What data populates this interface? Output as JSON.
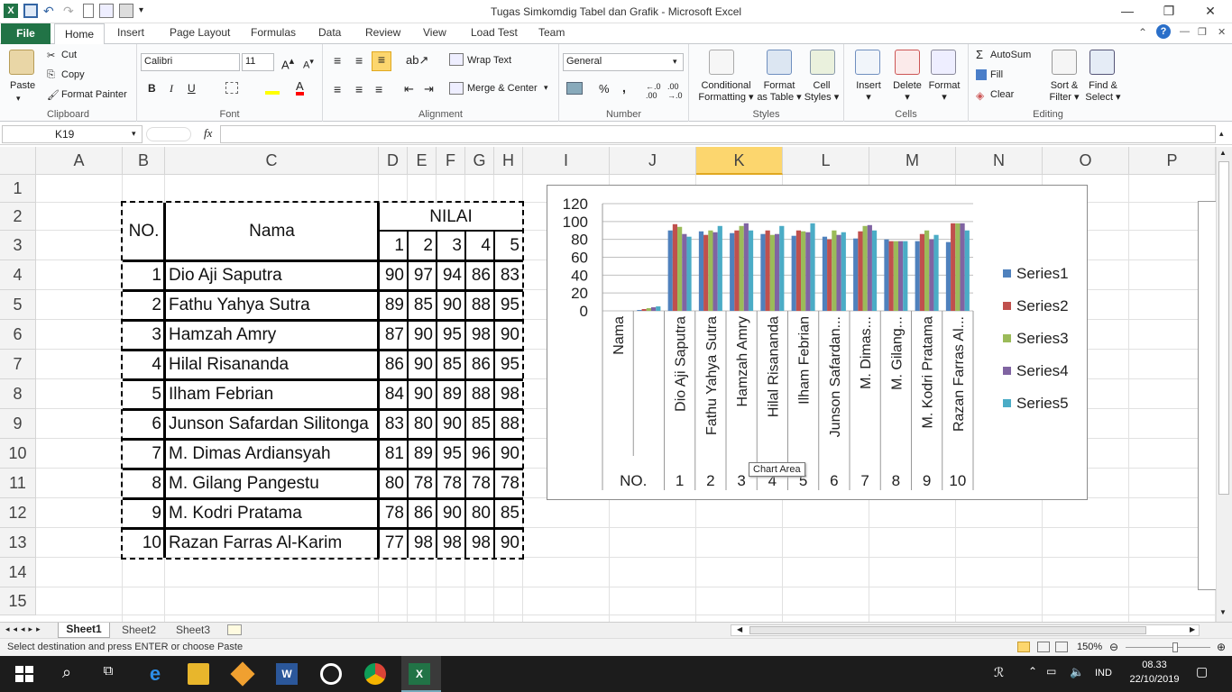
{
  "window": {
    "title": "Tugas Simkomdig Tabel dan Grafik  -  Microsoft Excel"
  },
  "tabs": [
    "File",
    "Home",
    "Insert",
    "Page Layout",
    "Formulas",
    "Data",
    "Review",
    "View",
    "Load Test",
    "Team"
  ],
  "ribbon": {
    "clipboard": {
      "paste": "Paste",
      "cut": "Cut",
      "copy": "Copy",
      "format_painter": "Format Painter",
      "label": "Clipboard"
    },
    "font": {
      "name": "Calibri",
      "size": "11",
      "bold": "B",
      "italic": "I",
      "underline": "U",
      "label": "Font"
    },
    "alignment": {
      "wrap": "Wrap Text",
      "merge": "Merge & Center",
      "label": "Alignment"
    },
    "number": {
      "format": "General",
      "percent": "%",
      "comma": ",",
      "label": "Number"
    },
    "styles": {
      "conditional_1": "Conditional",
      "conditional_2": "Formatting",
      "format_table_1": "Format",
      "format_table_2": "as Table",
      "cell_styles_1": "Cell",
      "cell_styles_2": "Styles",
      "label": "Styles"
    },
    "cells": {
      "insert": "Insert",
      "delete": "Delete",
      "format": "Format",
      "label": "Cells"
    },
    "editing": {
      "autosum": "AutoSum",
      "fill": "Fill",
      "clear": "Clear",
      "sort_1": "Sort &",
      "sort_2": "Filter",
      "find_1": "Find &",
      "find_2": "Select",
      "label": "Editing"
    }
  },
  "formula_bar": {
    "name_box": "K19",
    "fx": "fx",
    "value": ""
  },
  "columns": [
    "A",
    "B",
    "C",
    "D",
    "E",
    "F",
    "G",
    "H",
    "I",
    "J",
    "K",
    "L",
    "M",
    "N",
    "O",
    "P"
  ],
  "rows": [
    "1",
    "2",
    "3",
    "4",
    "5",
    "6",
    "7",
    "8",
    "9",
    "10",
    "11",
    "12",
    "13",
    "14",
    "15"
  ],
  "table": {
    "header_no": "NO.",
    "header_nama": "Nama",
    "header_nilai": "NILAI",
    "sub_headers": [
      "1",
      "2",
      "3",
      "4",
      "5"
    ],
    "data": [
      {
        "no": "1",
        "nama": "Dio Aji Saputra",
        "v": [
          "90",
          "97",
          "94",
          "86",
          "83"
        ]
      },
      {
        "no": "2",
        "nama": "Fathu Yahya Sutra",
        "v": [
          "89",
          "85",
          "90",
          "88",
          "95"
        ]
      },
      {
        "no": "3",
        "nama": "Hamzah Amry",
        "v": [
          "87",
          "90",
          "95",
          "98",
          "90"
        ]
      },
      {
        "no": "4",
        "nama": "Hilal Risananda",
        "v": [
          "86",
          "90",
          "85",
          "86",
          "95"
        ]
      },
      {
        "no": "5",
        "nama": "Ilham Febrian",
        "v": [
          "84",
          "90",
          "89",
          "88",
          "98"
        ]
      },
      {
        "no": "6",
        "nama": "Junson Safardan Silitonga",
        "v": [
          "83",
          "80",
          "90",
          "85",
          "88"
        ]
      },
      {
        "no": "7",
        "nama": "M. Dimas Ardiansyah",
        "v": [
          "81",
          "89",
          "95",
          "96",
          "90"
        ]
      },
      {
        "no": "8",
        "nama": "M. Gilang Pangestu",
        "v": [
          "80",
          "78",
          "78",
          "78",
          "78"
        ]
      },
      {
        "no": "9",
        "nama": "M. Kodri Pratama",
        "v": [
          "78",
          "86",
          "90",
          "80",
          "85"
        ]
      },
      {
        "no": "10",
        "nama": "Razan Farras Al-Karim",
        "v": [
          "77",
          "98",
          "98",
          "98",
          "90"
        ]
      }
    ]
  },
  "chart_data": {
    "type": "bar",
    "y_ticks": [
      "120",
      "100",
      "80",
      "60",
      "40",
      "20",
      "0"
    ],
    "ylim": [
      0,
      120
    ],
    "categories_outer": [
      "NO.",
      "1",
      "2",
      "3",
      "4",
      "5",
      "6",
      "7",
      "8",
      "9",
      "10"
    ],
    "categories_inner": [
      "Nama",
      "",
      "Dio Aji Saputra",
      "Fathu Yahya Sutra",
      "Hamzah Amry",
      "Hilal Risananda",
      "Ilham Febrian",
      "Junson Safardan...",
      "M. Dimas...",
      "M. Gilang...",
      "M. Kodri Pratama",
      "Razan Farras Al..."
    ],
    "series": [
      {
        "name": "Series1",
        "color": "#4f81bd",
        "values": [
          0,
          1,
          90,
          89,
          87,
          86,
          84,
          83,
          81,
          80,
          78,
          77
        ]
      },
      {
        "name": "Series2",
        "color": "#c0504d",
        "values": [
          0,
          2,
          97,
          85,
          90,
          90,
          90,
          80,
          89,
          78,
          86,
          98
        ]
      },
      {
        "name": "Series3",
        "color": "#9bbb59",
        "values": [
          0,
          3,
          94,
          90,
          95,
          85,
          89,
          90,
          95,
          78,
          90,
          98
        ]
      },
      {
        "name": "Series4",
        "color": "#8064a2",
        "values": [
          0,
          4,
          86,
          88,
          98,
          86,
          88,
          85,
          96,
          78,
          80,
          98
        ]
      },
      {
        "name": "Series5",
        "color": "#4bacc6",
        "values": [
          0,
          5,
          83,
          95,
          90,
          95,
          98,
          88,
          90,
          78,
          85,
          90
        ]
      }
    ],
    "legend_position": "right",
    "tooltip": "Chart Area"
  },
  "sheets": [
    "Sheet1",
    "Sheet2",
    "Sheet3"
  ],
  "status": {
    "message": "Select destination and press ENTER or choose Paste",
    "zoom": "150%"
  },
  "taskbar": {
    "lang": "IND",
    "time": "08.33",
    "date": "22/10/2019"
  }
}
